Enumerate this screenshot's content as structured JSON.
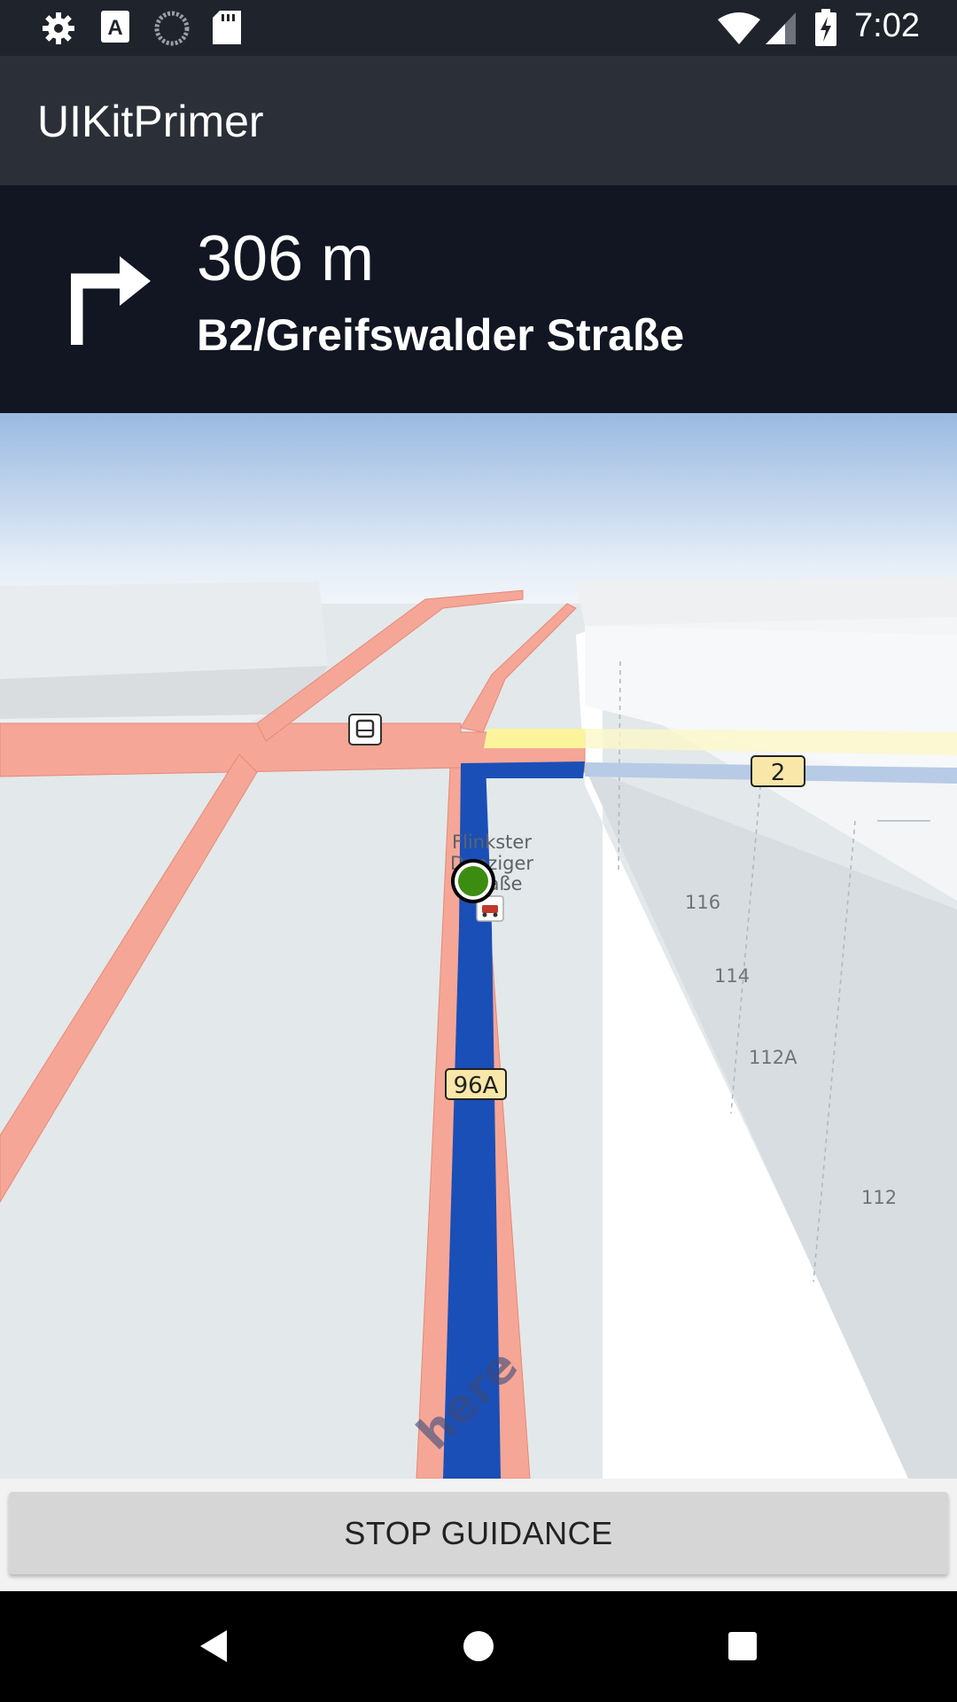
{
  "status_bar": {
    "time": "7:02",
    "left_icons": [
      "settings-icon",
      "text-a-icon",
      "sync-circle-icon",
      "sd-card-icon"
    ],
    "right_icons": [
      "wifi-icon",
      "signal-icon",
      "battery-charging-icon"
    ]
  },
  "app_bar": {
    "title": "UIKitPrimer"
  },
  "maneuver": {
    "icon": "turn-right-arrow-icon",
    "distance": "306 m",
    "street": "B2/Greifswalder Straße"
  },
  "map": {
    "road_labels": {
      "b2": "2",
      "road_96a": "96A"
    },
    "poi_label": [
      "Flinkster",
      "Danziger",
      "Straße"
    ],
    "house_numbers": [
      "116",
      "114",
      "112A",
      "112"
    ],
    "watermark": "here",
    "colors": {
      "route": "#1a4fb8",
      "road": "#f6a696",
      "position": "#3d8c12",
      "sky_top": "#9ab9e0"
    }
  },
  "actions": {
    "stop_guidance": "STOP GUIDANCE"
  },
  "nav_bar": {
    "icons": [
      "back-icon",
      "home-icon",
      "recents-icon"
    ]
  }
}
